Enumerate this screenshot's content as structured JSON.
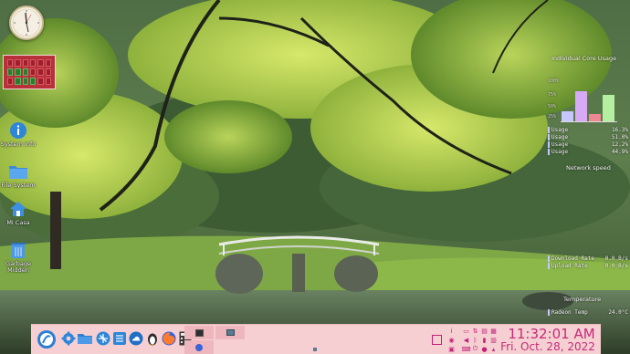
{
  "desktop": {
    "icons": [
      {
        "label": "System Info"
      },
      {
        "label": "File System"
      },
      {
        "label": "Mi Casa"
      },
      {
        "label": "Garbage Midden"
      }
    ],
    "pager": {
      "active_cells": [
        6,
        7,
        8,
        13,
        14,
        15
      ]
    }
  },
  "conky": {
    "core_title": "Individual Core Usage",
    "axis_ticks": [
      "100%",
      "75%",
      "50%",
      "25%"
    ],
    "cores": [
      {
        "label": "Usage",
        "value": "16.3%",
        "fraction": 0.163,
        "color": "#c9c6ff"
      },
      {
        "label": "Usage",
        "value": "51.0%",
        "fraction": 0.51,
        "color": "#d8a9f5"
      },
      {
        "label": "Usage",
        "value": "12.2%",
        "fraction": 0.122,
        "color": "#f08893"
      },
      {
        "label": "Usage",
        "value": "44.9%",
        "fraction": 0.449,
        "color": "#b5f0a0"
      }
    ],
    "network_title": "Network speed",
    "download_label": "Download Rate",
    "download_value": "0.0 B/s",
    "upload_label": "Upload Rate",
    "upload_value": "0.0 B/s",
    "temp_title": "Temperature",
    "temp_label": "Radeon Temp",
    "temp_value": "24.0°C"
  },
  "taskbar": {
    "launchers": [
      {
        "name": "app-menu-icon"
      },
      {
        "name": "settings-icon"
      },
      {
        "name": "folder-icon"
      },
      {
        "name": "network-icon"
      },
      {
        "name": "list-icon"
      },
      {
        "name": "cloud-icon"
      },
      {
        "name": "penguin-icon"
      },
      {
        "name": "firefox-icon"
      },
      {
        "name": "calculator-icon"
      }
    ],
    "clock_time": "11:32:01 AM",
    "clock_date": "Fri. Oct. 28, 2022",
    "accent": "#c42b7a"
  }
}
